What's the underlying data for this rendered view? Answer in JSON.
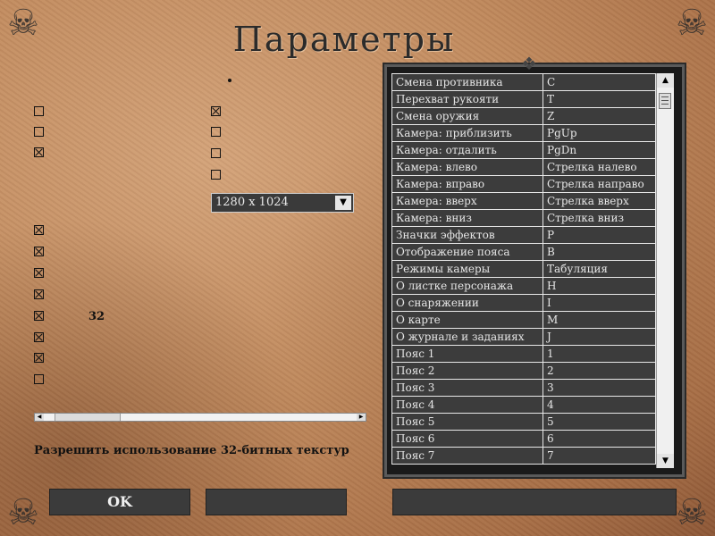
{
  "title": "Параметры",
  "settings": {
    "left_checkboxes": [
      {
        "checked": false
      },
      {
        "checked": false
      },
      {
        "checked": true
      },
      {
        "checked": true
      },
      {
        "checked": true
      },
      {
        "checked": true
      },
      {
        "checked": true
      },
      {
        "checked": true
      },
      {
        "checked": true
      },
      {
        "checked": true
      },
      {
        "checked": false
      }
    ],
    "right_checkboxes": [
      {
        "checked": true
      },
      {
        "checked": false
      },
      {
        "checked": false
      },
      {
        "checked": false
      }
    ],
    "resolution": {
      "selected": "1280 x 1024"
    },
    "texture_bits_label": "32",
    "hint": "Разрешить использование 32-битных текстур"
  },
  "keybindings": [
    {
      "action": "Смена противника",
      "key": "C"
    },
    {
      "action": "Перехват рукояти",
      "key": "T"
    },
    {
      "action": "Смена оружия",
      "key": "Z"
    },
    {
      "action": "Камера: приблизить",
      "key": "PgUp"
    },
    {
      "action": "Камера: отдалить",
      "key": "PgDn"
    },
    {
      "action": "Камера: влево",
      "key": "Стрелка налево"
    },
    {
      "action": "Камера: вправо",
      "key": "Стрелка направо"
    },
    {
      "action": "Камера: вверх",
      "key": "Стрелка вверх"
    },
    {
      "action": "Камера: вниз",
      "key": "Стрелка вниз"
    },
    {
      "action": "Значки эффектов",
      "key": "P"
    },
    {
      "action": "Отображение пояса",
      "key": "B"
    },
    {
      "action": "Режимы камеры",
      "key": "Табуляция"
    },
    {
      "action": "О листке персонажа",
      "key": "H"
    },
    {
      "action": "О снаряжении",
      "key": "I"
    },
    {
      "action": "О карте",
      "key": "M"
    },
    {
      "action": "О журнале и заданиях",
      "key": "J"
    },
    {
      "action": "Пояс 1",
      "key": "1"
    },
    {
      "action": "Пояс 2",
      "key": "2"
    },
    {
      "action": "Пояс 3",
      "key": "3"
    },
    {
      "action": "Пояс 4",
      "key": "4"
    },
    {
      "action": "Пояс 5",
      "key": "5"
    },
    {
      "action": "Пояс 6",
      "key": "6"
    },
    {
      "action": "Пояс 7",
      "key": "7"
    }
  ],
  "buttons": {
    "ok": "OK",
    "middle": "",
    "right": ""
  },
  "icons": {
    "dropdown": "chevron-down-icon",
    "corners": "skull-ornament-icon"
  }
}
